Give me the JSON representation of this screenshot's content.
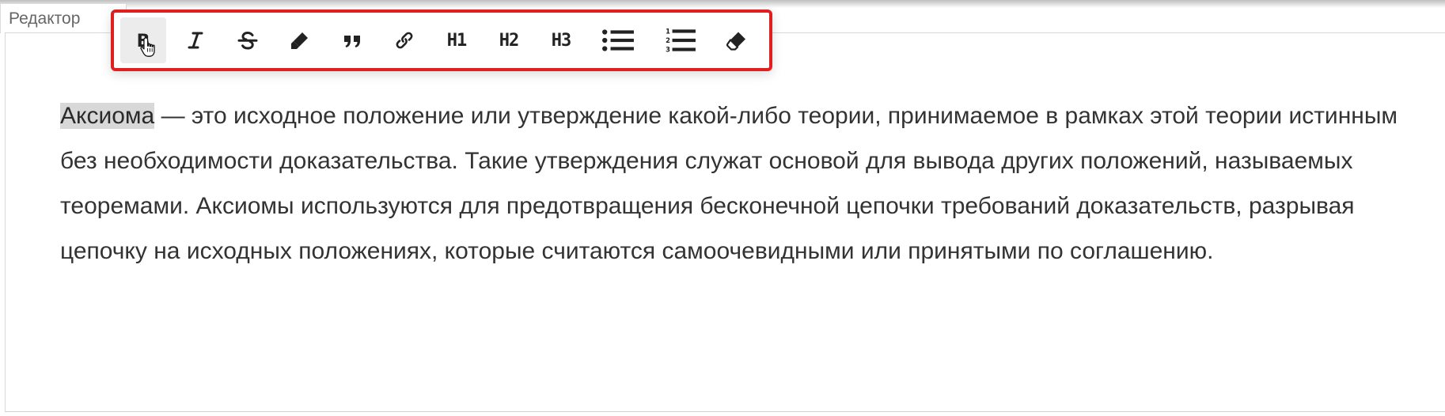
{
  "editor": {
    "tab_label": "Редактор"
  },
  "toolbar": {
    "buttons": [
      {
        "id": "bold",
        "icon": "bold-icon",
        "label": "B",
        "active": true
      },
      {
        "id": "italic",
        "icon": "italic-icon",
        "label": "I"
      },
      {
        "id": "strikethrough",
        "icon": "strikethrough-icon",
        "label": "S"
      },
      {
        "id": "highlight",
        "icon": "highlighter-icon"
      },
      {
        "id": "quote",
        "icon": "quote-icon"
      },
      {
        "id": "link",
        "icon": "link-icon"
      },
      {
        "id": "h1",
        "icon": "heading-1-icon",
        "label": "H1"
      },
      {
        "id": "h2",
        "icon": "heading-2-icon",
        "label": "H2"
      },
      {
        "id": "h3",
        "icon": "heading-3-icon",
        "label": "H3"
      },
      {
        "id": "bullet-list",
        "icon": "bullet-list-icon"
      },
      {
        "id": "numbered-list",
        "icon": "numbered-list-icon"
      },
      {
        "id": "clear-format",
        "icon": "eraser-icon"
      }
    ],
    "highlight_border_color": "#e02020"
  },
  "content": {
    "selected_word": "Аксиома",
    "rest": " — это исходное положение или утверждение какой-либо теории, принимаемое в рамках этой теории истинным без необходимости доказательства. Такие утверждения служат основой для вывода других положений, называемых теоремами. Аксиомы используются для предотвращения бесконечной цепочки требований доказательств, разрывая цепочку на исходных положениях, которые считаются самоочевидными или принятыми по соглашению.",
    "selection_color": "#d8d8d8",
    "text_color": "#333333"
  },
  "cursor": {
    "icon": "hand-pointer-icon"
  }
}
